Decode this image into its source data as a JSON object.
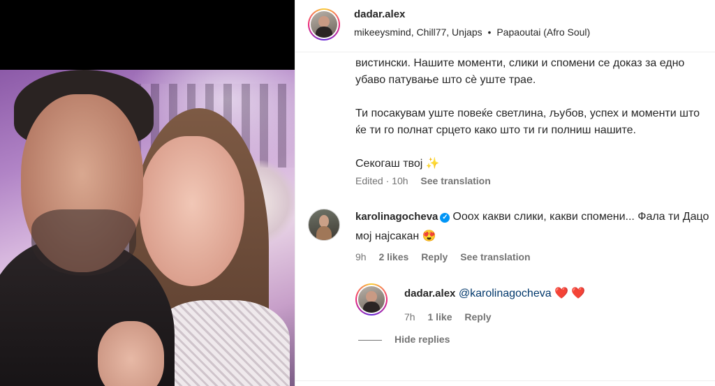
{
  "post": {
    "username": "dadar.alex",
    "audio": {
      "credits": "mikeeysmind, Chill77, Unjaps",
      "separator": "•",
      "track": "Papaoutai (Afro Soul)"
    }
  },
  "caption": {
    "paragraph_1": "вистински. Нашите моменти, слики и спомени се доказ за едно убаво патување што сè уште трае.",
    "paragraph_2": "Ти посакувам уште повеќе светлина, љубов, успех и моменти што ќе ти го полнат срцето како што ти ги полниш нашите.",
    "paragraph_3": "Секогаш твој ✨",
    "edited_label": "Edited",
    "time": "10h",
    "see_translation": "See translation"
  },
  "comment": {
    "username": "karolinagocheva",
    "verified_icon": "✓",
    "text": "Ооох какви слики, какви спомени... Фала ти Дацо мој најсакан 😍",
    "time": "9h",
    "likes": "2 likes",
    "reply_label": "Reply",
    "see_translation": "See translation"
  },
  "reply": {
    "username": "dadar.alex",
    "mention": "@karolinagocheva",
    "hearts": "❤️ ❤️",
    "time": "7h",
    "likes": "1 like",
    "reply_label": "Reply"
  },
  "thread": {
    "hide_replies": "Hide replies"
  },
  "colors": {
    "link_blue": "#00376b",
    "meta_gray": "#737373",
    "verified_blue": "#0095f6"
  }
}
